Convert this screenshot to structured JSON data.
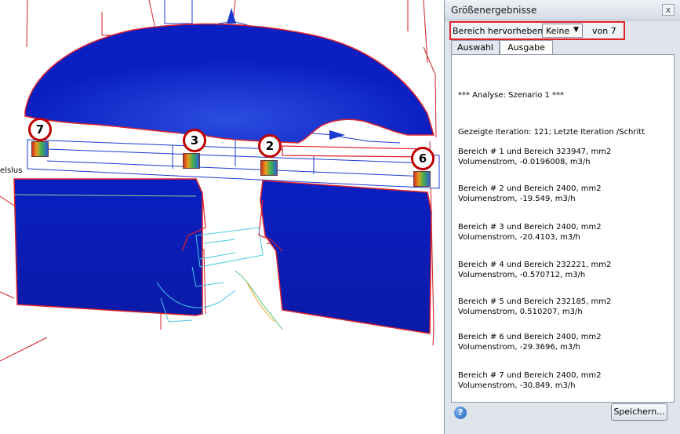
{
  "viewport": {
    "partial_label": "elslus",
    "markers": [
      "7",
      "3",
      "2",
      "6"
    ]
  },
  "panel": {
    "title": "Größenergebnisse",
    "close_glyph": "x",
    "highlight_label": "Bereich hervorheben:",
    "highlight_value": "Keine",
    "highlight_of": "von 7",
    "tabs": [
      "Auswahl",
      "Ausgabe"
    ],
    "active_tab": "Ausgabe",
    "content": {
      "analysis": "*** Analyse: Szenario 1 ***",
      "iteration": "Gezeigte Iteration: 121; Letzte Iteration /Schritt",
      "regions": [
        {
          "line1": "Bereich # 1 und Bereich 323947, mm2",
          "line2": "Volumenstrom,  -0.0196008, m3/h"
        },
        {
          "line1": "Bereich # 2 und Bereich 2400, mm2",
          "line2": "Volumenstrom,  -19.549, m3/h"
        },
        {
          "line1": "Bereich # 3 und Bereich 2400, mm2",
          "line2": "Volumenstrom,  -20.4103, m3/h"
        },
        {
          "line1": "Bereich # 4 und Bereich 232221, mm2",
          "line2": "Volumenstrom,  -0.570712, m3/h"
        },
        {
          "line1": "Bereich # 5 und Bereich 232185, mm2",
          "line2": "Volumenstrom,  0.510207, m3/h"
        },
        {
          "line1": "Bereich # 6 und Bereich 2400, mm2",
          "line2": "Volumenstrom,  -29.3696, m3/h"
        },
        {
          "line1": "Bereich # 7 und Bereich 2400, mm2",
          "line2": "Volumenstrom,  -30.849, m3/h"
        }
      ]
    },
    "help_glyph": "?",
    "save_label": "Speichern..."
  },
  "colors": {
    "surface_blue": "#0a1fc2",
    "edge_red": "#e0212a",
    "highlight_border": "#e0212a",
    "panel_bg": "#dfe3ea"
  }
}
